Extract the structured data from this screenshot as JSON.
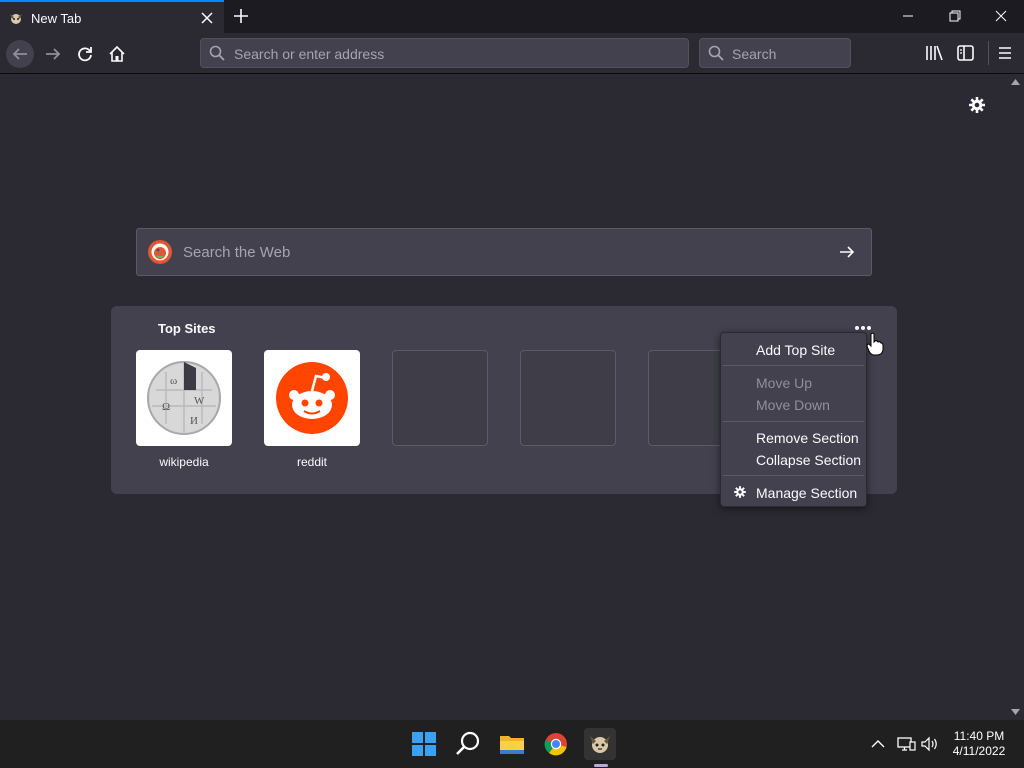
{
  "tab": {
    "title": "New Tab"
  },
  "urlbar": {
    "placeholder": "Search or enter address"
  },
  "searchbar": {
    "placeholder": "Search"
  },
  "websearch": {
    "placeholder": "Search the Web"
  },
  "topsites": {
    "heading": "Top Sites",
    "tiles": [
      {
        "label": "wikipedia",
        "icon": "wikipedia-globe-icon"
      },
      {
        "label": "reddit",
        "icon": "reddit-alien-icon"
      },
      {
        "label": ""
      },
      {
        "label": ""
      },
      {
        "label": ""
      }
    ]
  },
  "menu": {
    "items": [
      {
        "label": "Add Top Site",
        "enabled": true
      },
      {
        "label": "Move Up",
        "enabled": false
      },
      {
        "label": "Move Down",
        "enabled": false
      },
      {
        "label": "Remove Section",
        "enabled": true
      },
      {
        "label": "Collapse Section",
        "enabled": true
      },
      {
        "label": "Manage Section",
        "enabled": true,
        "icon": "gear-icon"
      }
    ]
  },
  "clock": {
    "time": "11:40 PM",
    "date": "4/11/2022"
  },
  "colors": {
    "accent": "#0a84ff",
    "reddit": "#ff4500",
    "background": "#2b2a33"
  }
}
